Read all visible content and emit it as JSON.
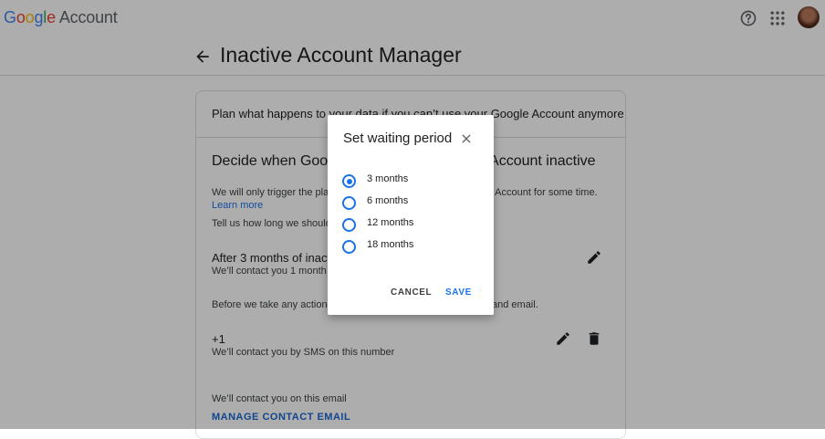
{
  "header": {
    "logo_letters": [
      "G",
      "o",
      "o",
      "g",
      "l",
      "e"
    ],
    "logo_suffix": "Account",
    "help_icon": "help-circle-icon",
    "apps_icon": "apps-grid-icon",
    "avatar_icon": "account-avatar"
  },
  "page": {
    "title": "Inactive Account Manager",
    "back_icon": "arrow-back-icon"
  },
  "card": {
    "intro": "Plan what happens to your data if you can’t use your Google Account anymore",
    "section_title_left": "Decide when Google",
    "section_title_right": "le Account inactive",
    "trigger_text_left": "We will only trigger the plan",
    "trigger_text_right": "gle Account for some time.",
    "learn_more": "Learn more",
    "tell_us": "Tell us how long we should",
    "period_title": "After 3 months of inactiv",
    "period_sub": "We’ll contact you 1 month b",
    "before_left": "Before we take any action, w",
    "before_right": "and email.",
    "phone_title": "+1",
    "phone_sub": "We’ll contact you by SMS on this number",
    "email_sub": "We’ll contact you on this email",
    "manage_email": "MANAGE CONTACT EMAIL"
  },
  "dialog": {
    "title": "Set waiting period",
    "options": [
      {
        "label": "3 months",
        "selected": true
      },
      {
        "label": "6 months",
        "selected": false
      },
      {
        "label": "12 months",
        "selected": false
      },
      {
        "label": "18 months",
        "selected": false
      }
    ],
    "cancel": "CANCEL",
    "save": "SAVE"
  },
  "colors": {
    "accent": "#1a73e8",
    "scrim": "rgba(0,0,0,0.32)"
  }
}
